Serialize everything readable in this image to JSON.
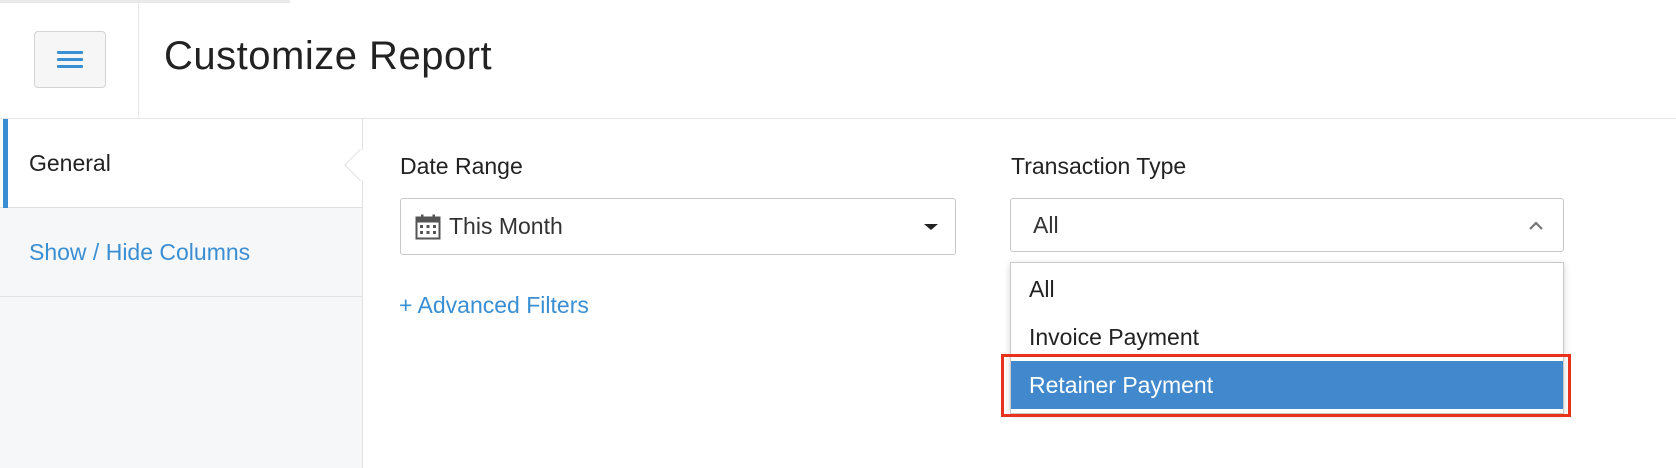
{
  "header": {
    "title": "Customize Report",
    "menu_icon": "hamburger-menu-icon"
  },
  "sidebar": {
    "items": [
      {
        "label": "General",
        "active": true
      },
      {
        "label": "Show / Hide Columns",
        "active": false
      }
    ]
  },
  "filters": {
    "date_range": {
      "label": "Date Range",
      "value": "This Month",
      "icon": "calendar-icon"
    },
    "transaction_type": {
      "label": "Transaction Type",
      "value": "All",
      "options": [
        "All",
        "Invoice Payment",
        "Retainer Payment"
      ],
      "highlighted_option": "Retainer Payment"
    },
    "advanced_filters_label": "+ Advanced Filters"
  },
  "colors": {
    "accent": "#3a8fd3",
    "selected_option_bg": "#4189cc",
    "highlight_border": "#e8321e",
    "sidebar_bg": "#f6f7f9"
  }
}
